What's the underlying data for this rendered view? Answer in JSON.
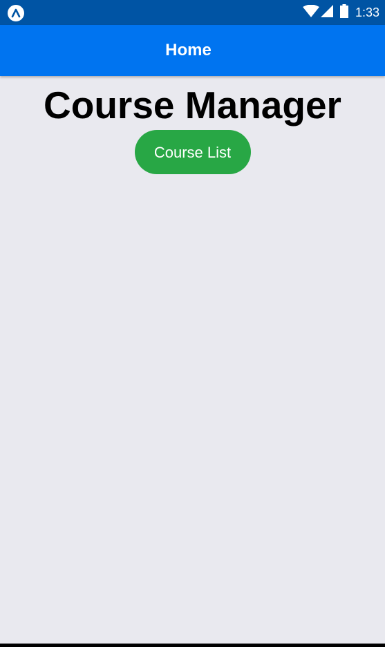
{
  "status_bar": {
    "time": "1:33",
    "icons": [
      "app-logo-icon",
      "wifi-icon",
      "signal-icon",
      "battery-icon"
    ],
    "background_color": "#0054a4"
  },
  "header": {
    "title": "Home",
    "background_color": "#0074f0"
  },
  "main": {
    "title": "Course Manager",
    "course_list_button_label": "Course List",
    "button_color": "#28a745",
    "background_color": "#e9e9ef"
  }
}
